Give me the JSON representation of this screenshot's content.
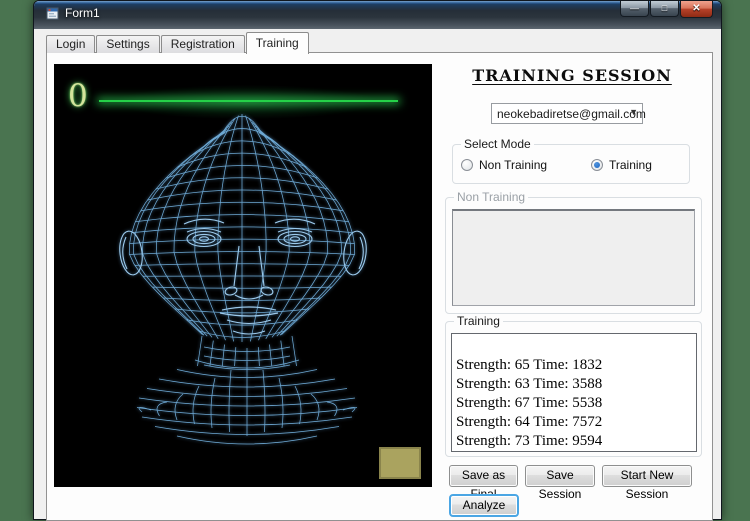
{
  "window": {
    "title": "Form1"
  },
  "icons": {
    "minimize": "—",
    "maximize": "□",
    "close": "✕",
    "combo_arrow": "▼"
  },
  "tabs": [
    {
      "label": "Login",
      "active": false
    },
    {
      "label": "Settings",
      "active": false
    },
    {
      "label": "Registration",
      "active": false
    },
    {
      "label": "Training",
      "active": true
    }
  ],
  "visualizer": {
    "counter": "0",
    "signal_line_color": "#25d148",
    "wireframe_color": "#6ea9d4",
    "swatch_color": "#aaa35f"
  },
  "session": {
    "title": "TRAINING SESSION",
    "email": {
      "value": "neokebadiretse@gmail.com"
    },
    "select_mode": {
      "label": "Select Mode",
      "options": [
        {
          "label": "Non Training",
          "selected": false
        },
        {
          "label": "Training",
          "selected": true
        }
      ]
    },
    "non_training": {
      "label": "Non Training",
      "content": "",
      "disabled": true
    },
    "training": {
      "label": "Training",
      "lines": [
        "Strength: 65 Time: 1832",
        "Strength: 63 Time: 3588",
        "Strength: 67 Time: 5538",
        "Strength: 64 Time: 7572",
        "Strength: 73 Time: 9594"
      ]
    },
    "buttons": [
      {
        "label": "Save as Final"
      },
      {
        "label": "Save Session"
      },
      {
        "label": "Start New Session"
      }
    ],
    "analyze": {
      "label": "Analyze"
    }
  },
  "colors": {
    "desktop_background": "#4a7450"
  }
}
